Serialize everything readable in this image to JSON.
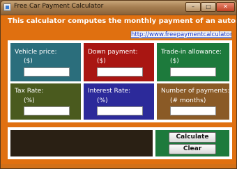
{
  "window": {
    "title": "Free Car Payment Calculator",
    "controls": {
      "minimize": "–",
      "maximize": "□",
      "close": "✕"
    }
  },
  "header": {
    "description": "This calculator computes the monthly payment of an automobile loan.",
    "link": "http://www.freepaymentcalculators.com"
  },
  "fields": [
    {
      "label": "Vehicle price:",
      "unit": "($)",
      "value": "",
      "color": "#2b6e7c"
    },
    {
      "label": "Down payment:",
      "unit": "($)",
      "value": "",
      "color": "#a91612"
    },
    {
      "label": "Trade-in allowance:",
      "unit": "($)",
      "value": "",
      "color": "#1d7a3c"
    },
    {
      "label": "Tax Rate:",
      "unit": "(%)",
      "value": "",
      "color": "#4a5a1e"
    },
    {
      "label": "Interest Rate:",
      "unit": "(%)",
      "value": "",
      "color": "#2c2a9a"
    },
    {
      "label": "Number of payments:",
      "unit": "(# months)",
      "value": "",
      "color": "#8a5a26"
    }
  ],
  "actions": {
    "calculate": "Calculate",
    "clear": "Clear"
  },
  "result": {
    "text": ""
  },
  "theme": {
    "background": "#e07010",
    "result_panel": "#2a2014"
  }
}
